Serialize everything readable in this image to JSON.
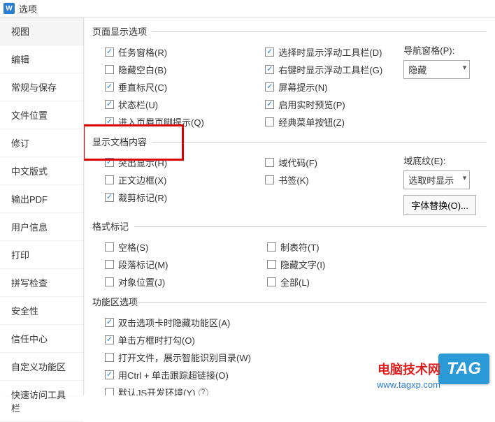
{
  "window": {
    "title": "选项",
    "icon_letter": "W"
  },
  "sidebar": {
    "items": [
      "视图",
      "编辑",
      "常规与保存",
      "文件位置",
      "修订",
      "中文版式",
      "输出PDF",
      "用户信息",
      "打印",
      "拼写检查",
      "安全性",
      "信任中心",
      "自定义功能区",
      "快速访问工具栏"
    ],
    "active_index": 0
  },
  "sections": {
    "page_display": {
      "title": "页面显示选项",
      "col1": [
        {
          "label": "任务窗格(R)",
          "checked": true
        },
        {
          "label": "隐藏空白(B)",
          "checked": false
        },
        {
          "label": "垂直标尺(C)",
          "checked": true
        },
        {
          "label": "状态栏(U)",
          "checked": true
        },
        {
          "label": "进入页眉页脚提示(Q)",
          "checked": true
        }
      ],
      "col2": [
        {
          "label": "选择时显示浮动工具栏(D)",
          "checked": true
        },
        {
          "label": "右键时显示浮动工具栏(G)",
          "checked": true
        },
        {
          "label": "屏幕提示(N)",
          "checked": true
        },
        {
          "label": "启用实时预览(P)",
          "checked": true
        },
        {
          "label": "经典菜单按钮(Z)",
          "checked": false
        }
      ],
      "side": {
        "label": "导航窗格(P):",
        "value": "隐藏"
      }
    },
    "doc_content": {
      "title": "显示文档内容",
      "col1": [
        {
          "label": "突出显示(H)",
          "checked": true
        },
        {
          "label": "正文边框(X)",
          "checked": false
        },
        {
          "label": "裁剪标记(R)",
          "checked": true
        }
      ],
      "col2": [
        {
          "label": "域代码(F)",
          "checked": false
        },
        {
          "label": "书签(K)",
          "checked": false
        }
      ],
      "side": {
        "label": "域底纹(E):",
        "value": "选取时显示",
        "button": "字体替换(O)..."
      }
    },
    "format_mark": {
      "title": "格式标记",
      "col1": [
        {
          "label": "空格(S)",
          "checked": false
        },
        {
          "label": "段落标记(M)",
          "checked": false
        },
        {
          "label": "对象位置(J)",
          "checked": false
        }
      ],
      "col2": [
        {
          "label": "制表符(T)",
          "checked": false
        },
        {
          "label": "隐藏文字(I)",
          "checked": false
        },
        {
          "label": "全部(L)",
          "checked": false
        }
      ]
    },
    "ribbon": {
      "title": "功能区选项",
      "col1": [
        {
          "label": "双击选项卡时隐藏功能区(A)",
          "checked": true
        },
        {
          "label": "单击方框时打勾(O)",
          "checked": true
        },
        {
          "label": "打开文件，展示智能识别目录(W)",
          "checked": false
        },
        {
          "label": "用Ctrl + 单击跟踪超链接(O)",
          "checked": true
        },
        {
          "label": "默认JS开发环境(Y)",
          "checked": false,
          "help": true
        }
      ]
    }
  },
  "watermark": {
    "text": "电脑技术网",
    "url": "www.tagxp.com",
    "tag": "TAG"
  }
}
